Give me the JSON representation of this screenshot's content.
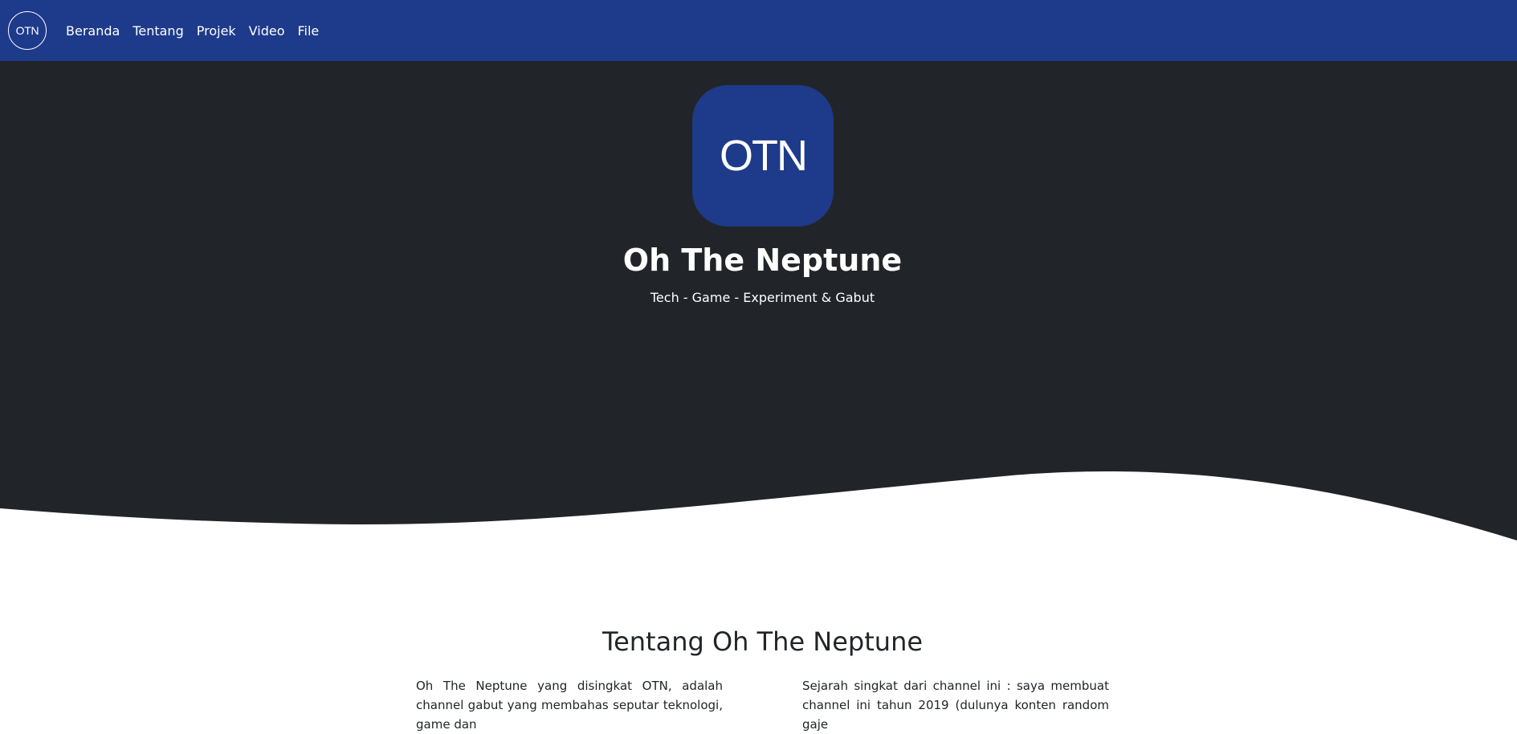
{
  "navbar": {
    "brand": "OTN",
    "links": [
      {
        "label": "Beranda"
      },
      {
        "label": "Tentang"
      },
      {
        "label": "Projek"
      },
      {
        "label": "Video"
      },
      {
        "label": "File"
      }
    ],
    "background": "#1e3a8a"
  },
  "hero": {
    "logo_text": "OTN",
    "title": "Oh The Neptune",
    "subtitle": "Tech - Game - Experiment & Gabut",
    "background": "#212529"
  },
  "about": {
    "title": "Tentang Oh The Neptune",
    "left_text": "Oh The Neptune yang disingkat OTN, adalah channel gabut yang membahas seputar teknologi, game dan",
    "right_text": "Sejarah singkat dari channel ini : saya membuat channel ini tahun 2019 (dulunya konten random gaje"
  }
}
